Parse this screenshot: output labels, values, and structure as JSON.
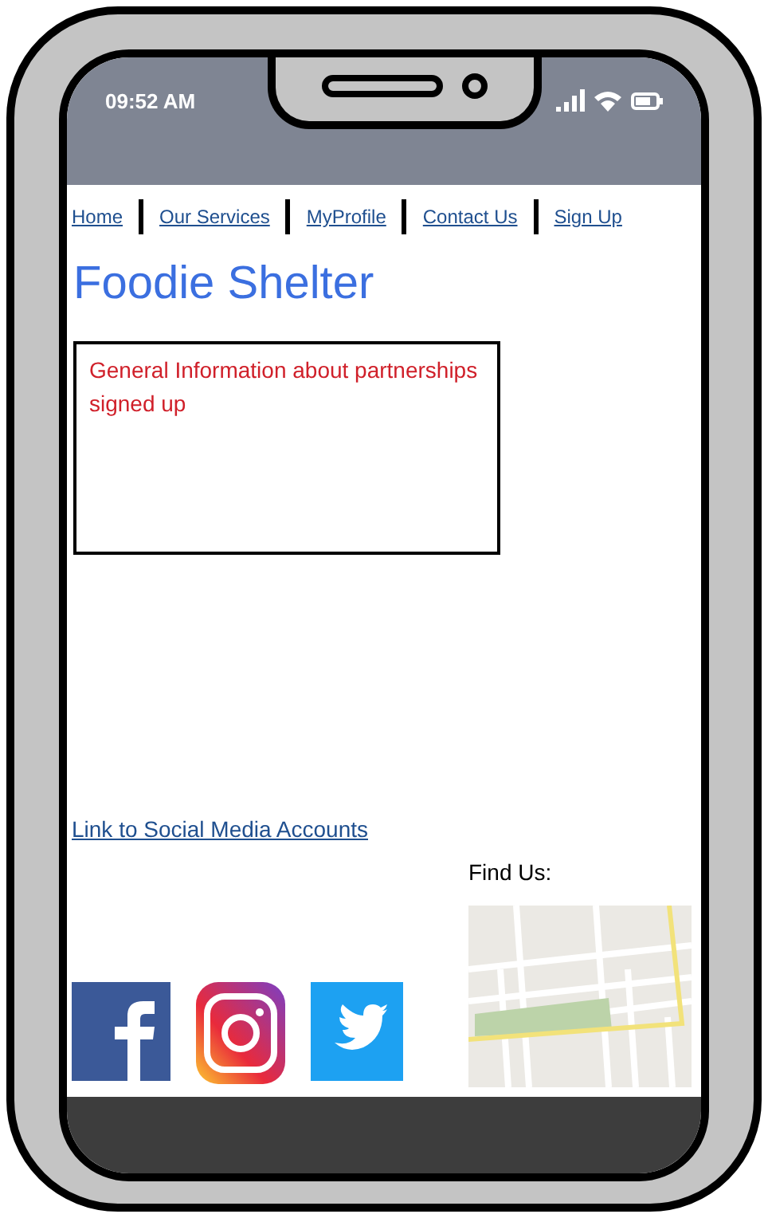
{
  "status_bar": {
    "time": "09:52 AM"
  },
  "nav": [
    "Home",
    "Our Services",
    "MyProfile",
    "Contact Us",
    "Sign Up"
  ],
  "title": "Foodie Shelter",
  "info_box": {
    "text": "General Information about partnerships signed up"
  },
  "social_link": "Link to Social Media Accounts",
  "find_us": {
    "label": "Find Us:"
  }
}
